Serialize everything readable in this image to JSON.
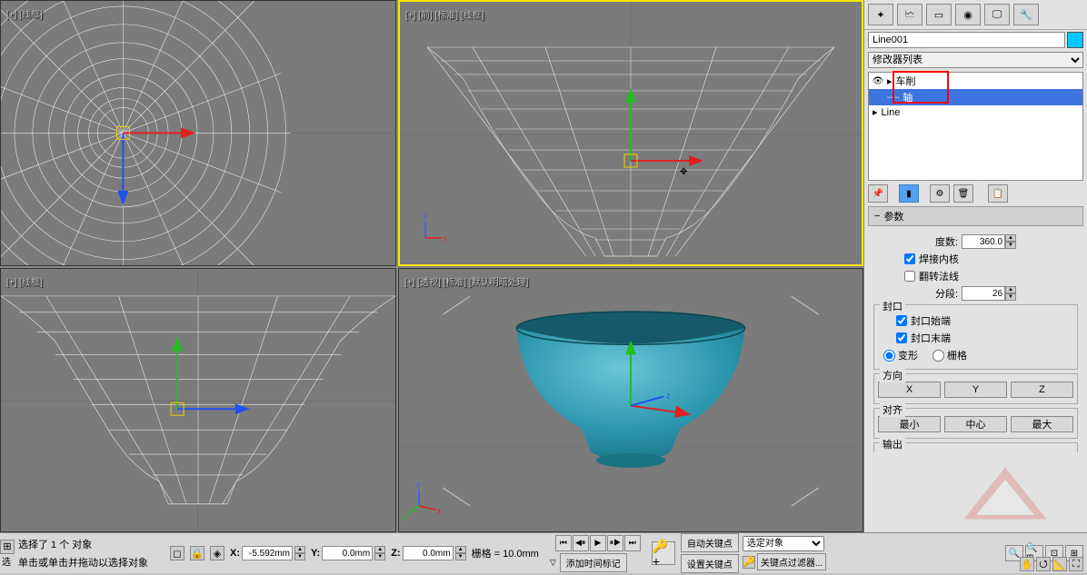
{
  "viewports": {
    "top": "[+] [线框]",
    "front": "[+] [前] [标准] [线框]",
    "left": "[+] [线框]",
    "persp": "[+] [透视] [标准] [默认明暗处理]"
  },
  "object_name": "Line001",
  "modifier_list_label": "修改器列表",
  "stack": {
    "item0": "车削",
    "item1": "轴",
    "item2": "Line"
  },
  "rollouts": {
    "params": "参数",
    "degrees_label": "度数:",
    "degrees_value": "360.0",
    "weld_core": "焊接内核",
    "flip_normals": "翻转法线",
    "segments_label": "分段:",
    "segments_value": "26",
    "cap_group": "封口",
    "cap_start": "封口始端",
    "cap_end": "封口末端",
    "morph": "变形",
    "grid": "栅格",
    "direction_group": "方向",
    "dir_x": "X",
    "dir_y": "Y",
    "dir_z": "Z",
    "align_group": "对齐",
    "align_min": "最小",
    "align_center": "中心",
    "align_max": "最大",
    "output": "输出"
  },
  "status": {
    "selected": "选择了 1 个 对象",
    "hint": "单击或单击并拖动以选择对象",
    "x_label": "X:",
    "x_value": "-5.592mm",
    "y_label": "Y:",
    "y_value": "0.0mm",
    "z_label": "Z:",
    "z_value": "0.0mm",
    "grid_text": "栅格 = 10.0mm",
    "add_time_tag": "添加时间标记",
    "auto_key": "自动关键点",
    "set_key": "设置关键点",
    "sel_obj": "选定对象",
    "key_filter": "关键点过滤器..."
  },
  "left_prefix": "选"
}
